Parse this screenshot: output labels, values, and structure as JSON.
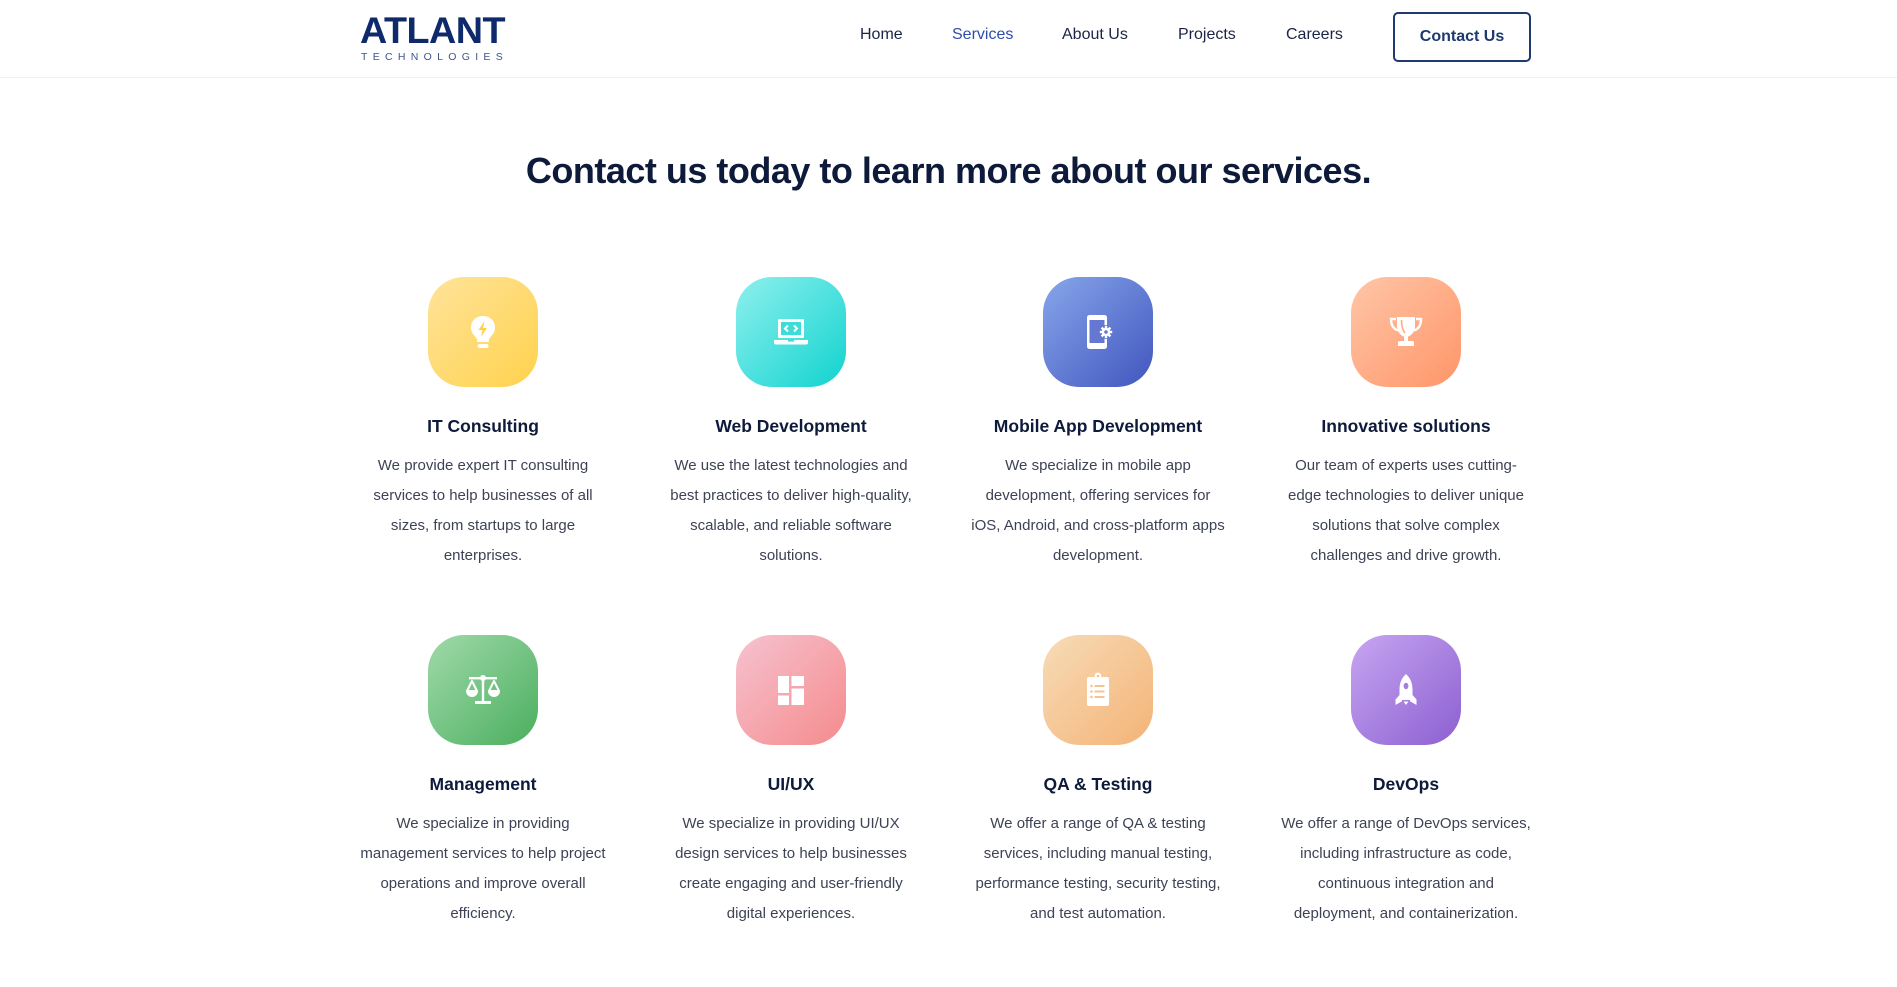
{
  "header": {
    "logo": {
      "main": "ATLANT",
      "sub": "TECHNOLOGIES"
    },
    "nav": [
      {
        "label": "Home",
        "active": false
      },
      {
        "label": "Services",
        "active": true
      },
      {
        "label": "About Us",
        "active": false
      },
      {
        "label": "Projects",
        "active": false
      },
      {
        "label": "Careers",
        "active": false
      }
    ],
    "cta_label": "Contact Us"
  },
  "main": {
    "headline": "Contact us today to learn more about our services.",
    "services": [
      {
        "icon": "lightbulb-bolt-icon",
        "color": "#ffd24d",
        "title": "IT Consulting",
        "description": "We provide expert IT consulting services to help businesses of all sizes, from startups to large enterprises."
      },
      {
        "icon": "laptop-code-icon",
        "color": "#11d3cf",
        "title": "Web Development",
        "description": "We use the latest technologies and best practices to deliver high-quality, scalable, and reliable software solutions."
      },
      {
        "icon": "mobile-gear-icon",
        "color": "#4156bf",
        "title": "Mobile App Development",
        "description": "We specialize in mobile app development, offering services for iOS, Android, and cross-platform apps development."
      },
      {
        "icon": "trophy-icon",
        "color": "#ff9568",
        "title": "Innovative solutions",
        "description": "Our team of experts uses cutting-edge technologies to deliver unique solutions that solve complex challenges and drive growth."
      },
      {
        "icon": "scale-balance-icon",
        "color": "#4aaf5e",
        "title": "Management",
        "description": "We specialize in providing management services to help project operations and improve overall efficiency."
      },
      {
        "icon": "layout-dashboard-icon",
        "color": "#f58b8d",
        "title": "UI/UX",
        "description": "We specialize in providing UI/UX design services to help businesses create engaging and user-friendly digital experiences."
      },
      {
        "icon": "clipboard-list-icon",
        "color": "#f4b377",
        "title": "QA & Testing",
        "description": "We offer a range of QA & testing services, including manual testing, performance testing, security testing, and test automation."
      },
      {
        "icon": "rocket-icon",
        "color": "#8c5fd1",
        "title": "DevOps",
        "description": "We offer a range of DevOps services, including infrastructure as code, continuous integration and deployment, and containerization."
      }
    ]
  }
}
